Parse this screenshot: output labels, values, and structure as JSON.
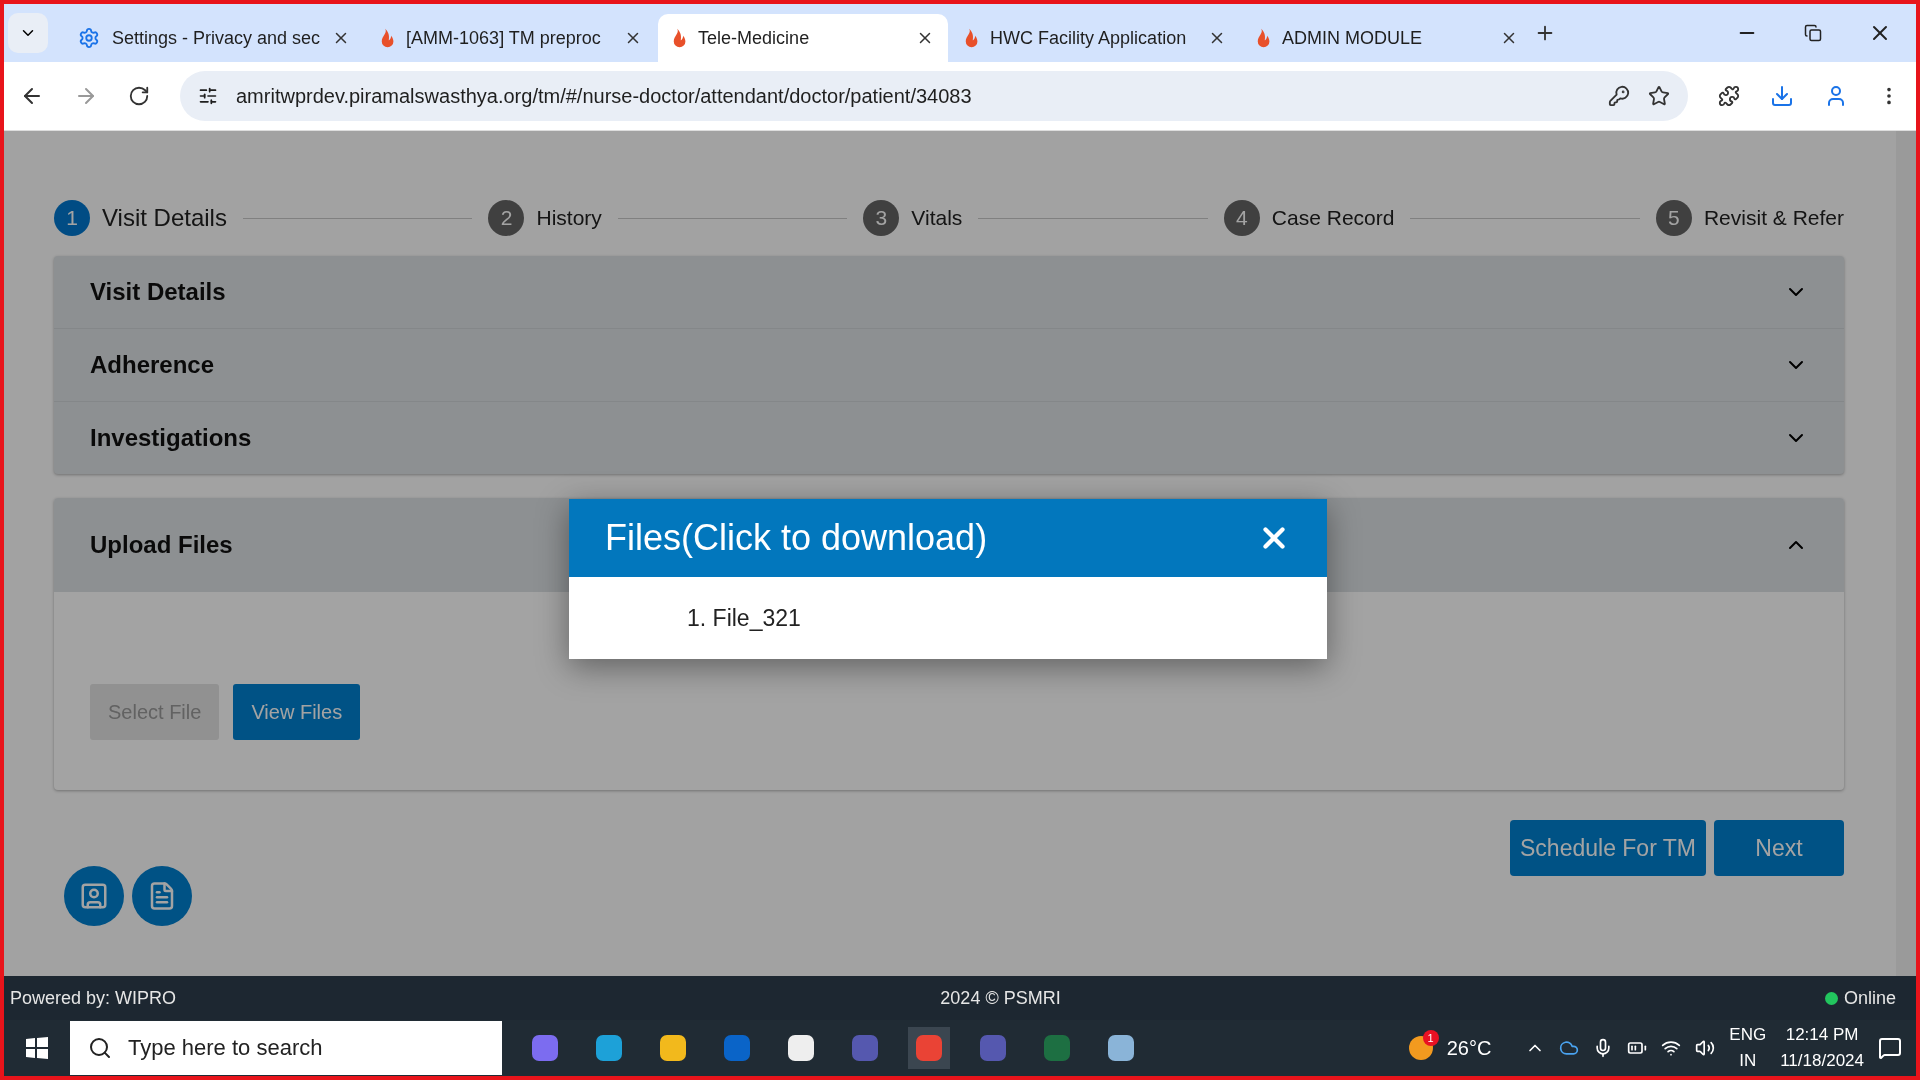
{
  "browser": {
    "tabs": [
      {
        "title": "Settings - Privacy and sec",
        "kind": "settings",
        "selected": false
      },
      {
        "title": "[AMM-1063] TM preproc",
        "kind": "app",
        "selected": false
      },
      {
        "title": "Tele-Medicine",
        "kind": "app",
        "selected": true
      },
      {
        "title": "HWC Facility Application",
        "kind": "app",
        "selected": false
      },
      {
        "title": "ADMIN MODULE",
        "kind": "app",
        "selected": false
      }
    ],
    "address": "amritwprdev.piramalswasthya.org/tm/#/nurse-doctor/attendant/doctor/patient/34083"
  },
  "stepper": [
    {
      "number": "1",
      "label": "Visit Details",
      "selected": true
    },
    {
      "number": "2",
      "label": "History",
      "selected": false
    },
    {
      "number": "3",
      "label": "Vitals",
      "selected": false
    },
    {
      "number": "4",
      "label": "Case Record",
      "selected": false
    },
    {
      "number": "5",
      "label": "Revisit & Refer",
      "selected": false
    }
  ],
  "sections": [
    {
      "title": "Visit Details",
      "expanded": false
    },
    {
      "title": "Adherence",
      "expanded": false
    },
    {
      "title": "Investigations",
      "expanded": false
    }
  ],
  "upload": {
    "title": "Upload Files",
    "expanded": true,
    "buttons": [
      {
        "label": "Select File",
        "disabled": true
      },
      {
        "label": "View Files",
        "disabled": false
      }
    ]
  },
  "actions": [
    "Schedule For TM",
    "Next"
  ],
  "dialog": {
    "title": "Files(Click to download)",
    "files": [
      {
        "number": "1.",
        "name": "File_321"
      }
    ]
  },
  "footer": {
    "left": "Powered by: WIPRO",
    "center": "2024 © PSMRI",
    "status": {
      "label": "Online",
      "color": "#22c55e"
    }
  },
  "taskbar": {
    "search_placeholder": "Type here to search",
    "weather": "26°C",
    "weather_badge": "1",
    "language": "ENG",
    "region": "IN",
    "time": "12:14 PM",
    "date": "11/18/2024"
  }
}
